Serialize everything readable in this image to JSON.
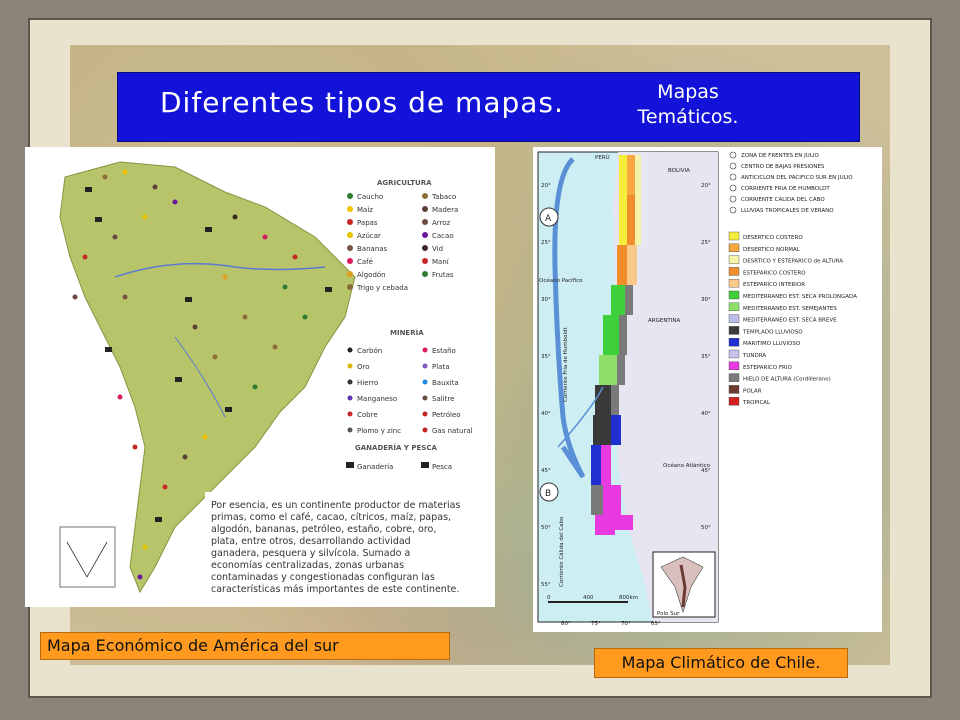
{
  "slide": {
    "title": "Diferentes tipos de mapas.",
    "subtitle_line1": "Mapas",
    "subtitle_line2": "Temáticos.",
    "caption_left": "Mapa Económico de América del sur",
    "caption_right": "Mapa Climático de Chile."
  },
  "colors": {
    "title_bar": "#1212d8",
    "caption_bg": "#ff9a1e",
    "continent": "#b8c46a"
  },
  "econ_map": {
    "section_agricultura": "AGRICULTURA",
    "agricultura": [
      "Caucho",
      "Tabaco",
      "Maíz",
      "Madera",
      "Papas",
      "Arroz",
      "Azúcar",
      "Cacao",
      "Bananas",
      "Vid",
      "Café",
      "Maní",
      "Algodón",
      "Frutas",
      "Trigo y cebada"
    ],
    "section_mineria": "MINERÍA",
    "mineria": [
      "Carbón",
      "Estaño",
      "Oro",
      "Plata",
      "Hierro",
      "Bauxita",
      "Manganeso",
      "Salitre",
      "Cobre",
      "Petróleo",
      "Plomo y zinc",
      "Gas natural"
    ],
    "section_ganaderia": "GANADERÍA Y PESCA",
    "ganaderia": [
      "Ganadería",
      "Pesca"
    ],
    "text_lines": [
      "Por esencia, es un continente productor de materias",
      "primas, como el café, cacao, cítricos, maíz, papas,",
      "algodón, bananas, petróleo, estaño, cobre, oro,",
      "plata, entre otros, desarrollando actividad",
      "ganadera, pesquera y silvícola. Sumado a",
      "economías centralizadas, zonas urbanas",
      "contaminadas y congestionadas configuran las",
      "características más importantes de este continente."
    ]
  },
  "chile_map": {
    "labels": {
      "peru": "PERÚ",
      "bolivia": "BOLIVIA",
      "argentina": "ARGENTINA",
      "oceano_pacifico": "Océano Pacífico",
      "oceano_atlantico": "Océano Atlántico",
      "corriente_humboldt": "Corriente Fría de Humboldt",
      "corriente_cabo": "Corriente Cálida del Cabo",
      "polo_sur": "Polo Sur",
      "a": "A",
      "b": "B"
    },
    "top_legend": [
      "ZONA DE FRENTES EN JULIO",
      "CENTRO DE BAJAS PRESIONES",
      "ANTICICLON DEL PACIFICO SUR EN JULIO",
      "CORRIENTE FRIA DE HUMBOLDT",
      "CORRIENTE CALIDA DEL CABO",
      "LLUVIAS TROPICALES DE VERANO"
    ],
    "climates": [
      {
        "label": "DESERTICO COSTERO",
        "color": "#f4ee3a"
      },
      {
        "label": "DESERTICO NORMAL",
        "color": "#f7a640"
      },
      {
        "label": "DESRTICO Y ESTEPARICO de ALTURA",
        "color": "#f6f3a8"
      },
      {
        "label": "ESTEPARICO COSTERO",
        "color": "#f08c2a"
      },
      {
        "label": "ESTEPARICO INTERIOR",
        "color": "#f9c98a"
      },
      {
        "label": "MEDITERRANEO EST. SECA PROLONGADA",
        "color": "#3fcf3a"
      },
      {
        "label": "MEDITERRANEO EST. SEMEJANTES",
        "color": "#8ee06a"
      },
      {
        "label": "MEDITERRANEO EST. SECA BREVE",
        "color": "#b9bde8"
      },
      {
        "label": "TEMPLADO LLUVIOSO",
        "color": "#3a3a3a"
      },
      {
        "label": "MARITIMO LLUVIOSO",
        "color": "#2030d0"
      },
      {
        "label": "TUNDRA",
        "color": "#c6c2f0"
      },
      {
        "label": "ESTEPARICO FRIO",
        "color": "#e83ae0"
      },
      {
        "label": "HIELO DE ALTURA (Cordillerano)",
        "color": "#7a7a7a"
      },
      {
        "label": "POLAR",
        "color": "#6b3a30"
      },
      {
        "label": "TROPICAL",
        "color": "#d42020"
      }
    ],
    "lat_labels": [
      "20°",
      "25°",
      "30°",
      "35°",
      "40°",
      "45°",
      "50°",
      "55°"
    ],
    "lon_labels": [
      "80°",
      "75°",
      "70°",
      "65°"
    ],
    "scale": [
      "0",
      "400",
      "800km"
    ]
  }
}
